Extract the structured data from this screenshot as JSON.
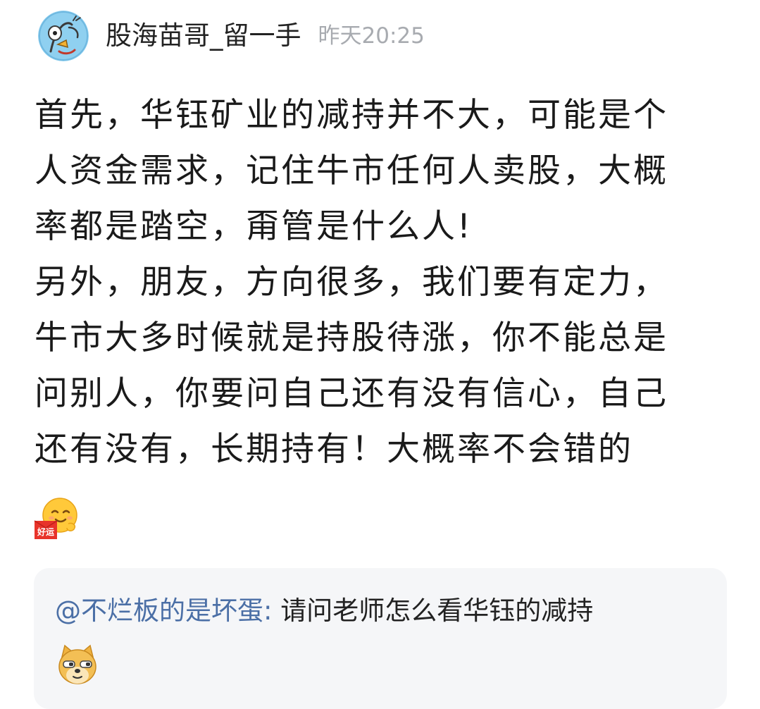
{
  "header": {
    "username": "股海苗哥_留一手",
    "time": "昨天20:25",
    "avatar_icon": "cartoon-avatar-icon"
  },
  "post": {
    "lines": [
      "首先，华钰矿业的减持并不大，可能是个",
      "人资金需求，记住牛市任何人卖股，大概",
      "率都是踏空，甭管是什么人!",
      "另外，朋友，方向很多，我们要有定力，",
      "牛市大多时候就是持股待涨，你不能总是",
      "问别人，你要问自己还有没有信心，自己",
      "还有没有，长期持有！大概率不会错的"
    ],
    "emoji": {
      "name": "good-luck-emoji",
      "label": "好运"
    }
  },
  "quote": {
    "mention": "@不烂板的是坏蛋:",
    "text": " 请问老师怎么看华钰的减持",
    "emoji": "doge-emoji"
  },
  "colors": {
    "mention": "#4b6fa6",
    "time": "#a8abb0",
    "quote_bg": "#f5f6f8",
    "text": "#1a1a1a"
  }
}
